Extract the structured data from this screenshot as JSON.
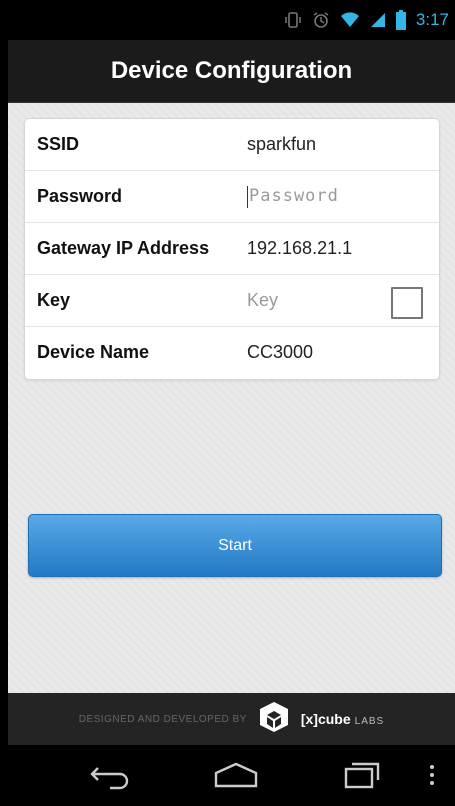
{
  "status_bar": {
    "time": "3:17",
    "icons": [
      "vibrate-icon",
      "alarm-icon",
      "wifi-icon",
      "signal-icon",
      "battery-icon"
    ]
  },
  "header": {
    "title": "Device Configuration"
  },
  "form": {
    "ssid": {
      "label": "SSID",
      "value": "sparkfun"
    },
    "password": {
      "label": "Password",
      "placeholder": "Password",
      "value": ""
    },
    "gateway": {
      "label": "Gateway IP Address",
      "value": "192.168.21.1"
    },
    "key": {
      "label": "Key",
      "placeholder": "Key",
      "value": "",
      "checked": false
    },
    "device_name": {
      "label": "Device Name",
      "value": "CC3000"
    }
  },
  "start_button": {
    "label": "Start"
  },
  "footer": {
    "credit": "DESIGNED AND DEVELOPED BY",
    "brand": "[x]cube",
    "brand_suffix": "LABS"
  },
  "nav": {
    "buttons": [
      "back-icon",
      "home-icon",
      "recent-apps-icon",
      "menu-icon"
    ]
  },
  "colors": {
    "accent": "#33b5e5",
    "button": "#2f86d0",
    "titlebar": "#1b1b1b"
  }
}
